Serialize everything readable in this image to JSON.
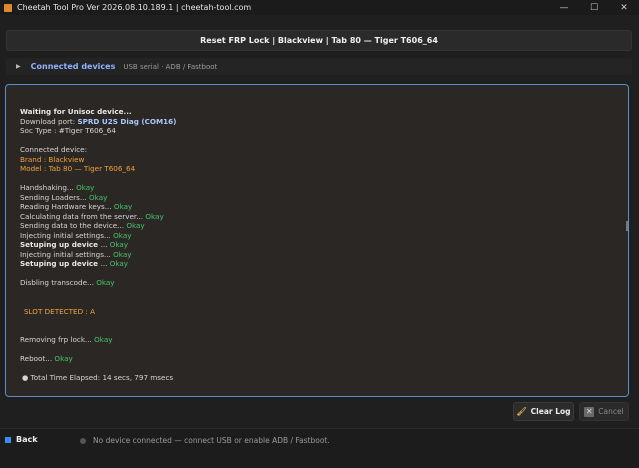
{
  "window": {
    "title": "Cheetah Tool Pro Ver 2026.08.10.189.1 | cheetah-tool.com",
    "minimize": "—",
    "maximize": "☐",
    "close": "✕"
  },
  "header": {
    "title": "Reset FRP Lock | Blackview | Tab 80 — Tiger T606_64"
  },
  "devices": {
    "chevron": "▶",
    "label": "Connected devices",
    "sub": "USB serial · ADB / Fastboot"
  },
  "log": {
    "waiting": "Waiting for Unisoc device...",
    "port_label": "Download port: ",
    "port_value": "SPRD U2S Diag (COM16)",
    "soc": "Soc Type :  #Tiger T606_64",
    "connected": "Connected device:",
    "brand": "Brand : Blackview",
    "model": "Model : Tab 80 — Tiger T606_64",
    "steps": [
      {
        "text": "Handshaking... ",
        "bold": false,
        "status": "Okay"
      },
      {
        "text": "Sending Loaders... ",
        "bold": false,
        "status": "Okay"
      },
      {
        "text": "Reading Hardware keys... ",
        "bold": false,
        "status": "Okay"
      },
      {
        "text": "Calculating data from the server... ",
        "bold": false,
        "status": "Okay"
      },
      {
        "text": "Sending data to the device... ",
        "bold": false,
        "status": "Okay"
      },
      {
        "text": "Injecting initial settings... ",
        "bold": false,
        "status": "Okay"
      },
      {
        "text": "Setuping up device ",
        "bold": true,
        "status": "Okay",
        "suffix": "... "
      },
      {
        "text": "Injecting initial settings... ",
        "bold": false,
        "status": "Okay"
      },
      {
        "text": "Setuping up device ",
        "bold": true,
        "status": "Okay",
        "suffix": "... "
      }
    ],
    "transcode_label": "Disbling transcode... ",
    "transcode_status": "Okay",
    "slot": "SLOT DETECTED : A",
    "frp_label": "Removing frp lock... ",
    "frp_status": "Okay",
    "reboot_label": "Reboot... ",
    "reboot_status": "Okay",
    "elapsed": "● Total Time Elapsed: 14 secs, 797 msecs"
  },
  "buttons": {
    "clear_log": "Clear Log",
    "cancel": "Cancel"
  },
  "status": {
    "back": "Back",
    "message": "No device connected — connect USB or enable ADB / Fastboot."
  }
}
